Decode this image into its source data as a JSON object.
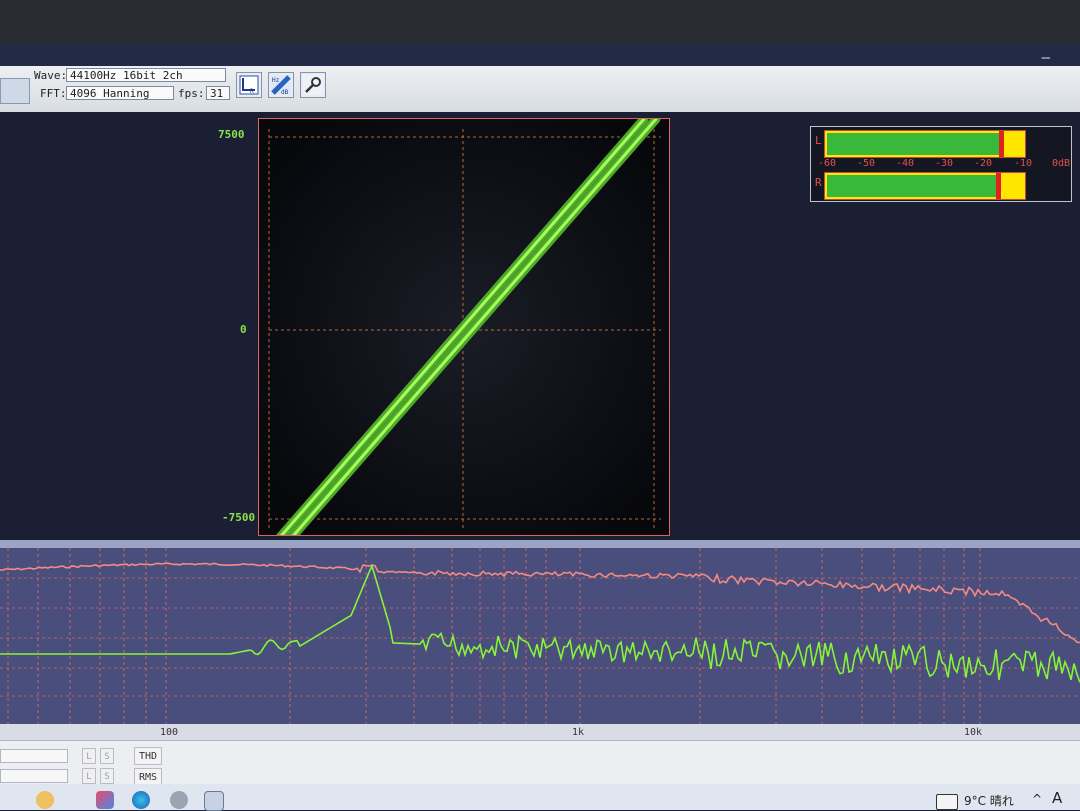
{
  "toolbar": {
    "wave_label": "Wave:",
    "wave_value": "44100Hz 16bit 2ch",
    "fft_label": "FFT:",
    "fft_value": "4096 Hanning",
    "fps_label": "fps:",
    "fps_value": "31"
  },
  "scope": {
    "y_max": "7500",
    "y_zero": "0",
    "y_min": "-7500"
  },
  "level_meter": {
    "left_channel": "L",
    "right_channel": "R",
    "scale": [
      "-60",
      "-50",
      "-40",
      "-30",
      "-20",
      "-10",
      "0dB"
    ],
    "left_level_fraction": 0.88,
    "right_level_fraction": 0.86
  },
  "spectrum": {
    "x_labels": [
      "100",
      "1k",
      "10k"
    ]
  },
  "bottom_panel": {
    "row1_btn_a": "L",
    "row1_btn_b": "S",
    "row2_btn_a": "L",
    "row2_btn_b": "S",
    "thd_label": "THD",
    "rms_label": "RMS"
  },
  "taskbar": {
    "weather": "9°C 晴れ",
    "ime": "A"
  },
  "colors": {
    "trace_green": "#7cf03a",
    "trace_red": "#f07a7a",
    "grid_orange": "#e08040"
  }
}
